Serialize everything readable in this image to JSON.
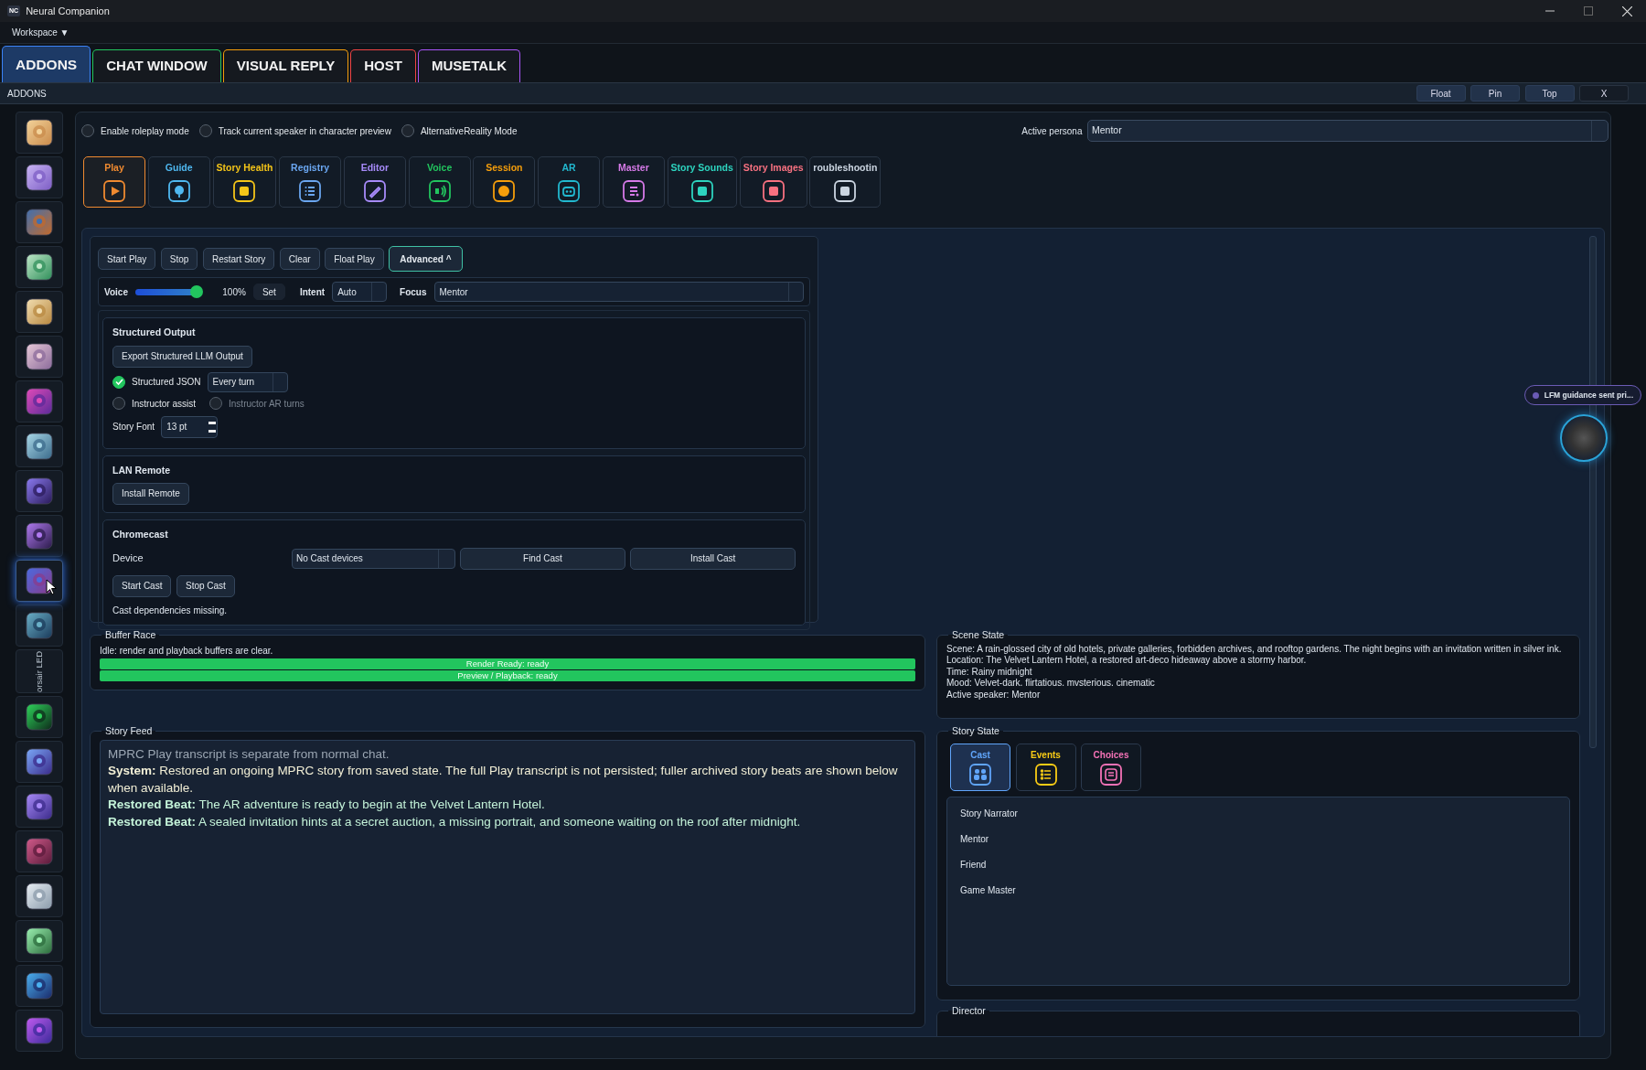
{
  "window": {
    "logo": "NC",
    "title": "Neural Companion"
  },
  "menu": {
    "label": "Workspace ▼"
  },
  "tabs": [
    {
      "label": "ADDONS",
      "color": "#3b82f6",
      "selected": true
    },
    {
      "label": "CHAT WINDOW",
      "color": "#22c55e",
      "selected": false
    },
    {
      "label": "VISUAL REPLY",
      "color": "#f59e0b",
      "selected": false
    },
    {
      "label": "HOST",
      "color": "#ef4444",
      "selected": false
    },
    {
      "label": "MUSETALK",
      "color": "#a855f7",
      "selected": false
    }
  ],
  "panel_header": {
    "title": "ADDONS",
    "buttons": [
      {
        "label": "Float",
        "kind": "filled"
      },
      {
        "label": "Pin",
        "kind": "filled"
      },
      {
        "label": "Top",
        "kind": "filled"
      },
      {
        "label": "X",
        "kind": "outline"
      }
    ]
  },
  "sidebar": {
    "items": [
      {
        "kind": "icon",
        "selected": false
      },
      {
        "kind": "icon",
        "selected": false
      },
      {
        "kind": "icon",
        "selected": false
      },
      {
        "kind": "icon",
        "selected": false
      },
      {
        "kind": "icon",
        "selected": false
      },
      {
        "kind": "icon",
        "selected": false
      },
      {
        "kind": "icon",
        "selected": false
      },
      {
        "kind": "icon",
        "selected": false
      },
      {
        "kind": "icon",
        "selected": false
      },
      {
        "kind": "icon",
        "selected": false
      },
      {
        "kind": "icon",
        "selected": true
      },
      {
        "kind": "icon",
        "selected": false
      },
      {
        "kind": "label",
        "label": "orsair LED",
        "selected": false
      },
      {
        "kind": "icon",
        "selected": false
      },
      {
        "kind": "icon",
        "selected": false
      },
      {
        "kind": "icon",
        "selected": false
      },
      {
        "kind": "icon",
        "selected": false
      },
      {
        "kind": "icon",
        "selected": false
      },
      {
        "kind": "icon",
        "selected": false
      },
      {
        "kind": "icon",
        "selected": false
      },
      {
        "kind": "icon",
        "selected": false
      }
    ]
  },
  "options": [
    {
      "label": "Enable roleplay mode",
      "checked": false
    },
    {
      "label": "Track current speaker in character preview",
      "checked": false
    },
    {
      "label": "AlternativeReality Mode",
      "checked": false
    }
  ],
  "active_persona": {
    "label": "Active persona",
    "value": "Mentor"
  },
  "tools": [
    {
      "label": "Play",
      "color": "#f08a30",
      "selected": true
    },
    {
      "label": "Guide",
      "color": "#4fb8f0",
      "selected": false
    },
    {
      "label": "Story Health",
      "color": "#f5c518",
      "selected": false
    },
    {
      "label": "Registry",
      "color": "#6aa6f0",
      "selected": false
    },
    {
      "label": "Editor",
      "color": "#a78bfa",
      "selected": false
    },
    {
      "label": "Voice",
      "color": "#22c55e",
      "selected": false
    },
    {
      "label": "Session",
      "color": "#f59e0b",
      "selected": false
    },
    {
      "label": "AR",
      "color": "#22b8cf",
      "selected": false
    },
    {
      "label": "Master",
      "color": "#d67ae8",
      "selected": false
    },
    {
      "label": "Story Sounds",
      "color": "#2dd4bf",
      "selected": false
    },
    {
      "label": "Story Images",
      "color": "#f87180",
      "selected": false
    },
    {
      "label": "roubleshootin",
      "color": "#cbd5e1",
      "selected": false
    }
  ],
  "play": {
    "buttons": [
      {
        "label": "Start Play",
        "selected": false
      },
      {
        "label": "Stop",
        "selected": false
      },
      {
        "label": "Restart Story",
        "selected": false
      },
      {
        "label": "Clear",
        "selected": false
      },
      {
        "label": "Float Play",
        "selected": false
      },
      {
        "label": "Advanced ^",
        "selected": true
      }
    ],
    "voice": {
      "label": "Voice",
      "level": 1,
      "reading": "100%",
      "set_button": "Set"
    },
    "intent": {
      "label": "Intent",
      "value": "Auto"
    },
    "focus": {
      "label": "Focus",
      "value": "Mentor"
    }
  },
  "structured_output": {
    "title": "Structured Output",
    "export_button": "Export Structured LLM Output",
    "structured_json": {
      "label": "Structured JSON",
      "checked": true,
      "value": "Every turn"
    },
    "instructor_assist": {
      "label": "Instructor assist",
      "checked": false
    },
    "instructor_ar_turns": {
      "label": "Instructor AR turns",
      "checked": false,
      "disabled": true
    },
    "story_font": {
      "label": "Story Font",
      "value": "13 pt"
    }
  },
  "lan_remote": {
    "title": "LAN Remote",
    "button": "Install Remote"
  },
  "chromecast": {
    "title": "Chromecast",
    "device_label": "Device",
    "device_value": "No Cast devices",
    "buttons": [
      "Find Cast",
      "Install Cast"
    ],
    "actions": [
      "Start Cast",
      "Stop Cast"
    ],
    "status": "Cast dependencies missing."
  },
  "buffer_race": {
    "title": "Buffer Race",
    "status": "Idle: render and playback buffers are clear.",
    "bars": [
      {
        "label": "Render Ready: ready",
        "level": 1
      },
      {
        "label": "Preview / Playback: ready",
        "level": 1
      }
    ]
  },
  "scene_state": {
    "title": "Scene State",
    "lines": [
      "Scene: A rain-glossed city of old hotels, private galleries, forbidden archives, and rooftop gardens. The night begins with an invitation written in silver ink.",
      "Location: The Velvet Lantern Hotel, a restored art-deco hideaway above a stormy harbor.",
      "Time: Rainy midnight",
      "Mood: Velvet-dark. flirtatious. mvsterious. cinematic",
      "Active speaker: Mentor"
    ]
  },
  "story_feed": {
    "title": "Story Feed",
    "intro": "MPRC Play transcript is separate from normal chat.",
    "entries": [
      {
        "text": "**System:** Restored an ongoing MPRC story from saved state. The full Play transcript is not persisted; fuller archived story beats are shown below when available.",
        "color": "#f2efd6"
      },
      {
        "text": "**Restored Beat:** The AR adventure is ready to begin at the Velvet Lantern Hotel.",
        "color": "#c4f3d9"
      },
      {
        "text": "**Restored Beat:** A sealed invitation hints at a secret auction, a missing portrait, and someone waiting on the roof after midnight.",
        "color": "#c4f3d9"
      }
    ]
  },
  "story_state": {
    "title": "Story State",
    "tabs": [
      {
        "label": "Cast",
        "color": "#60a5fa",
        "selected": true
      },
      {
        "label": "Events",
        "color": "#facc15",
        "selected": false
      },
      {
        "label": "Choices",
        "color": "#f472b6",
        "selected": false
      }
    ],
    "cast": [
      "Story Narrator",
      "Mentor",
      "Friend",
      "Game Master"
    ]
  },
  "director": {
    "title": "Director"
  },
  "guidance_pill": {
    "text": "LFM guidance sent pri..."
  }
}
